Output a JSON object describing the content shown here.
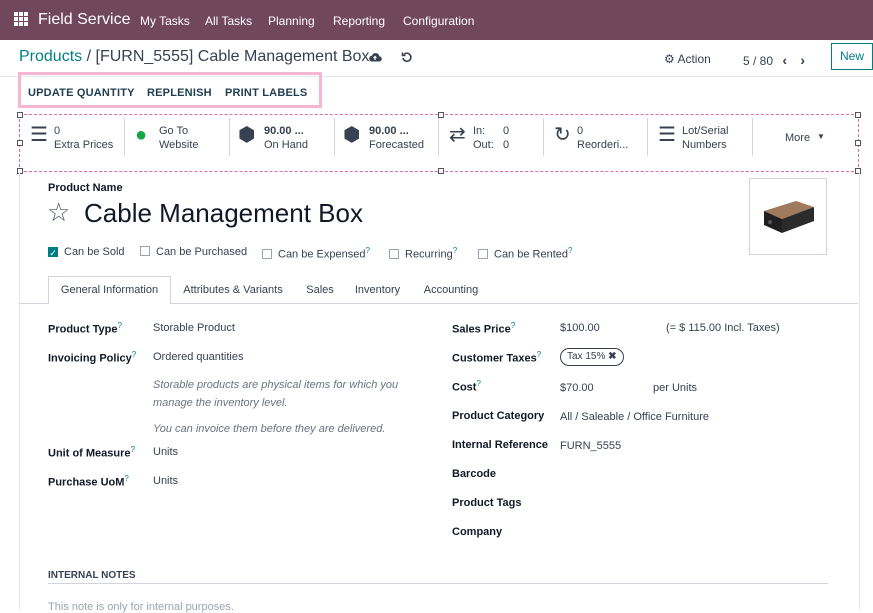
{
  "nav": {
    "app_name": "Field Service",
    "menu": [
      "My Tasks",
      "All Tasks",
      "Planning",
      "Reporting",
      "Configuration"
    ]
  },
  "breadcrumb": {
    "parent": "Products",
    "separator": "/",
    "current": "[FURN_5555] Cable Management Box"
  },
  "control": {
    "action_label": "Action",
    "pager": "5 / 80",
    "new_label": "New"
  },
  "status_buttons": [
    "UPDATE QUANTITY",
    "REPLENISH",
    "PRINT LABELS"
  ],
  "smart_buttons": [
    {
      "icon": "list-icon",
      "line1": "0",
      "line2": "Extra Prices"
    },
    {
      "icon": "globe-icon",
      "line1": "Go To",
      "line2": "Website"
    },
    {
      "icon": "cubes-icon",
      "line1": "90.00 ...",
      "line2": "On Hand"
    },
    {
      "icon": "cubes-icon",
      "line1": "90.00 ...",
      "line2": "Forecasted"
    },
    {
      "icon": "exchange-icon",
      "line1": "In:",
      "line1b": "0",
      "line2": "Out:",
      "line2b": "0"
    },
    {
      "icon": "refresh-icon",
      "line1": "0",
      "line2": "Reorderi..."
    },
    {
      "icon": "bars-icon",
      "line1": "Lot/Serial",
      "line2": "Numbers"
    }
  ],
  "more_label": "More",
  "product": {
    "name_label": "Product Name",
    "name": "Cable Management Box",
    "image": "cable-box-image"
  },
  "checkboxes": [
    {
      "label": "Can be Sold",
      "checked": true,
      "help": false
    },
    {
      "label": "Can be Purchased",
      "checked": false,
      "help": false
    },
    {
      "label": "Can be Expensed",
      "checked": false,
      "help": true
    },
    {
      "label": "Recurring",
      "checked": false,
      "help": true
    },
    {
      "label": "Can be Rented",
      "checked": false,
      "help": true
    }
  ],
  "tabs": [
    "General Information",
    "Attributes & Variants",
    "Sales",
    "Inventory",
    "Accounting"
  ],
  "left_fields": {
    "product_type": {
      "label": "Product Type",
      "value": "Storable Product"
    },
    "invoicing_policy": {
      "label": "Invoicing Policy",
      "value": "Ordered quantities"
    },
    "help1": "Storable products are physical items for which you",
    "help2": "manage the inventory level.",
    "help3": "You can invoice them before they are delivered.",
    "uom": {
      "label": "Unit of Measure",
      "value": "Units"
    },
    "purchase_uom": {
      "label": "Purchase UoM",
      "value": "Units"
    }
  },
  "right_fields": {
    "sales_price": {
      "label": "Sales Price",
      "value": "$100.00",
      "extra": "(= $ 115.00 Incl. Taxes)"
    },
    "customer_taxes": {
      "label": "Customer Taxes",
      "tag": "Tax 15%"
    },
    "cost": {
      "label": "Cost",
      "value": "$70.00",
      "extra": "per Units"
    },
    "category": {
      "label": "Product Category",
      "value": "All / Saleable / Office Furniture"
    },
    "internal_ref": {
      "label": "Internal Reference",
      "value": "FURN_5555"
    },
    "barcode": {
      "label": "Barcode"
    },
    "tags": {
      "label": "Product Tags"
    },
    "company": {
      "label": "Company"
    }
  },
  "notes": {
    "label": "INTERNAL NOTES",
    "placeholder": "This note is only for internal purposes."
  },
  "help_mark": "?",
  "colors": {
    "nav": "#71475e",
    "accent": "#017e84",
    "highlight": "#f4b6d2"
  }
}
